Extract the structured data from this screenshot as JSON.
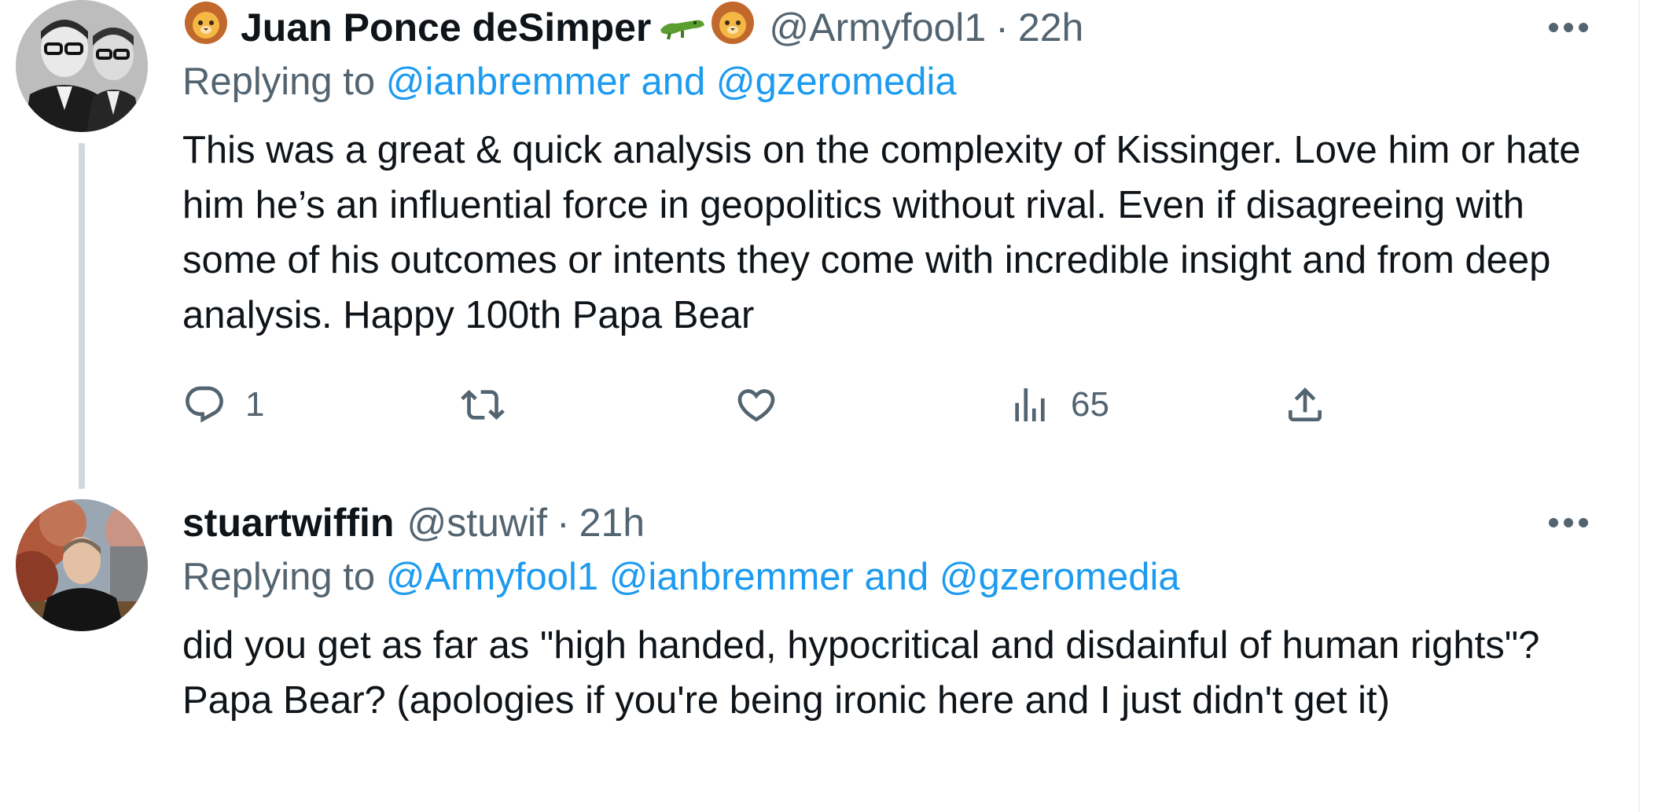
{
  "tweets": [
    {
      "display_name": "Juan Ponce deSimper",
      "name_emojis_before": "🦁",
      "name_emojis_after": [
        "🐊",
        "🦁"
      ],
      "handle": "@Armyfool1",
      "separator": "·",
      "time": "22h",
      "replying_prefix": "Replying to ",
      "replying_mentions": "@ianbremmer and @gzeromedia",
      "text": "This was a great & quick analysis on the complexity of Kissinger. Love him or hate him he’s an influential force in geopolitics without rival. Even if disagreeing with some of his outcomes or intents they come with incredible insight and from deep analysis. Happy 100th Papa Bear",
      "reply_count": "1",
      "views_count": "65",
      "avatar_icon": "avatar-two-men-bw-photo"
    },
    {
      "display_name": "stuartwiffin",
      "handle": "@stuwif",
      "separator": "·",
      "time": "21h",
      "replying_prefix": "Replying to ",
      "replying_mentions": "@Armyfool1 @ianbremmer and @gzeromedia",
      "text": "did you get as far as \"high handed, hypocritical and disdainful of human rights\"? Papa Bear? (apologies if you're being ironic here and I just didn't get it)",
      "avatar_icon": "avatar-man-outdoors-photo"
    }
  ],
  "colors": {
    "text": "#0f1419",
    "secondary": "#536471",
    "link": "#1d9bf0",
    "thread_line": "#cfd9de"
  },
  "icons": {
    "more": "more-horizontal-icon",
    "reply": "reply-icon",
    "retweet": "retweet-icon",
    "like": "heart-icon",
    "views": "views-bar-chart-icon",
    "share": "share-upload-icon"
  }
}
